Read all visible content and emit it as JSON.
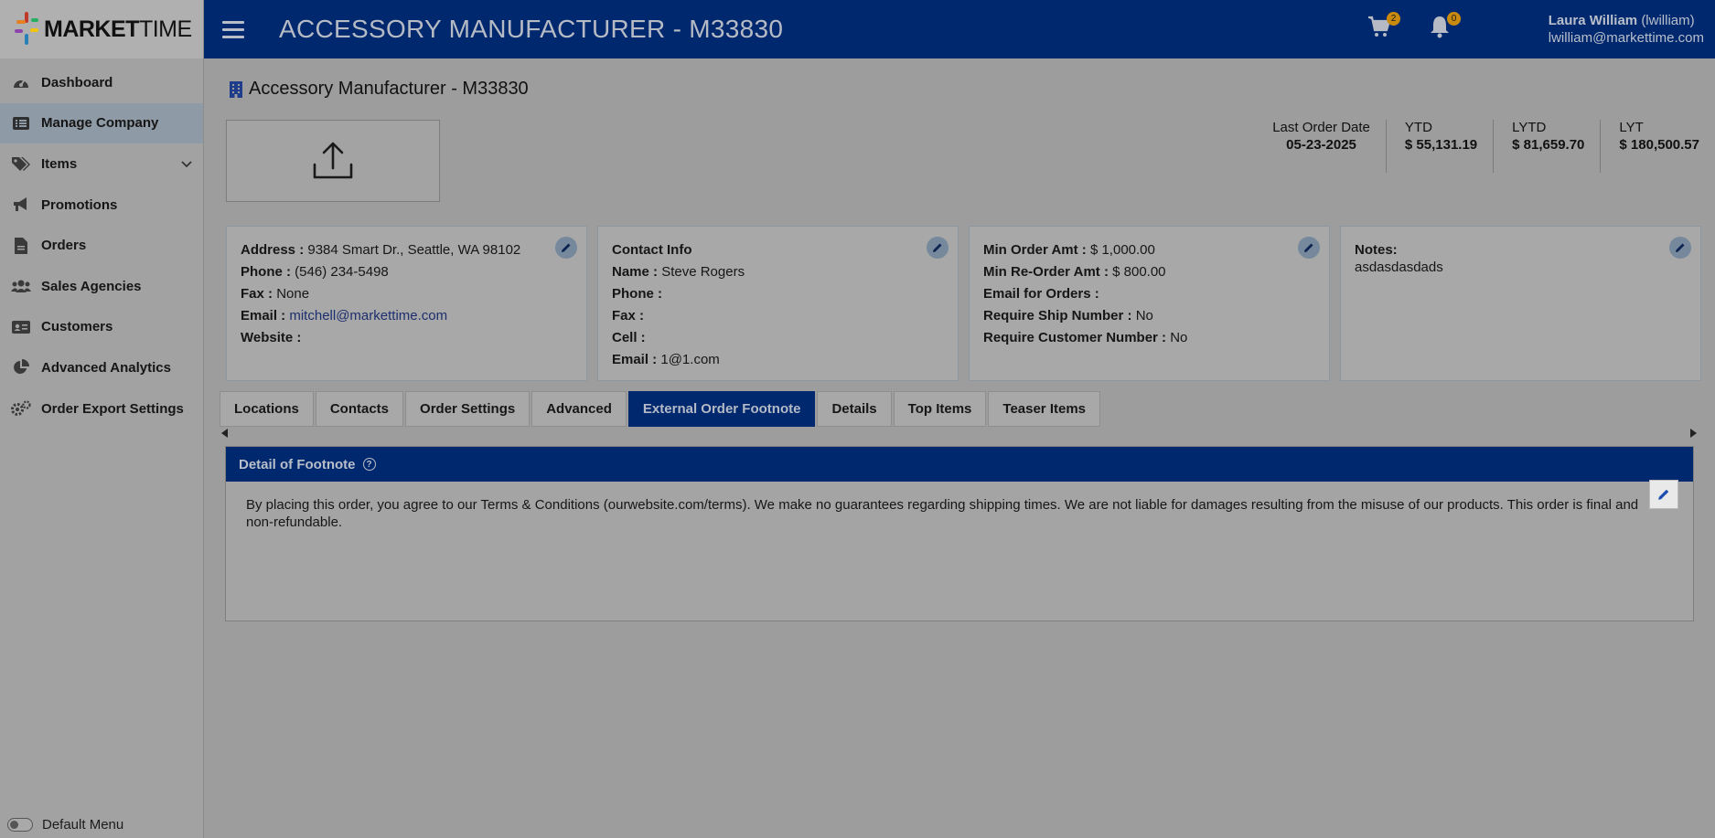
{
  "app": {
    "logo_bold": "MARKET",
    "logo_light": "TIME",
    "page_heading": "ACCESSORY MANUFACTURER - M33830"
  },
  "colors": {
    "brand_navy": "#00286e",
    "badge": "#c98a10"
  },
  "header": {
    "cart_count": "2",
    "notification_count": "0",
    "user_name": "Laura William",
    "user_handle": "(lwilliam)",
    "user_email": "lwilliam@markettime.com"
  },
  "sidebar": {
    "items": [
      {
        "label": "Dashboard",
        "icon": "dashboard-gauge-icon"
      },
      {
        "label": "Manage Company",
        "icon": "list-icon"
      },
      {
        "label": "Items",
        "icon": "tags-icon"
      },
      {
        "label": "Promotions",
        "icon": "megaphone-icon"
      },
      {
        "label": "Orders",
        "icon": "document-icon"
      },
      {
        "label": "Sales Agencies",
        "icon": "users-icon"
      },
      {
        "label": "Customers",
        "icon": "id-card-icon"
      },
      {
        "label": "Advanced Analytics",
        "icon": "pie-chart-icon"
      },
      {
        "label": "Order Export Settings",
        "icon": "gears-icon"
      }
    ],
    "default_menu_label": "Default Menu"
  },
  "company": {
    "title": "Accessory Manufacturer - M33830"
  },
  "stats": {
    "last_order_label": "Last Order Date",
    "last_order_value": "05-23-2025",
    "ytd_label": "YTD",
    "ytd_value": "$ 55,131.19",
    "lytd_label": "LYTD",
    "lytd_value": "$ 81,659.70",
    "lyt_label": "LYT",
    "lyt_value": "$ 180,500.57"
  },
  "address_card": {
    "address_label": "Address :",
    "address_value": "9384 Smart Dr., Seattle, WA 98102",
    "phone_label": "Phone :",
    "phone_value": "(546) 234-5498",
    "fax_label": "Fax :",
    "fax_value": "None",
    "email_label": "Email :",
    "email_value": "mitchell@markettime.com",
    "website_label": "Website :"
  },
  "contact_card": {
    "heading": "Contact Info",
    "name_label": "Name :",
    "name_value": "Steve Rogers",
    "phone_label": "Phone :",
    "fax_label": "Fax :",
    "cell_label": "Cell :",
    "email_label": "Email :",
    "email_value": "1@1.com"
  },
  "order_card": {
    "min_order_label": "Min Order Amt :",
    "min_order_value": "$ 1,000.00",
    "min_reorder_label": "Min Re-Order Amt :",
    "min_reorder_value": "$ 800.00",
    "email_orders_label": "Email for Orders :",
    "ship_number_label": "Require Ship Number :",
    "ship_number_value": "No",
    "customer_number_label": "Require Customer Number :",
    "customer_number_value": "No"
  },
  "notes_card": {
    "label": "Notes:",
    "value": "asdasdasdads"
  },
  "tabs": [
    {
      "label": "Locations"
    },
    {
      "label": "Contacts"
    },
    {
      "label": "Order Settings"
    },
    {
      "label": "Advanced"
    },
    {
      "label": "External Order Footnote",
      "active": true
    },
    {
      "label": "Details"
    },
    {
      "label": "Top Items"
    },
    {
      "label": "Teaser Items"
    }
  ],
  "footnote": {
    "heading": "Detail of Footnote",
    "help": "?",
    "text": "By placing this order, you agree to our Terms & Conditions (ourwebsite.com/terms). We make no guarantees regarding shipping times. We are not liable for damages resulting from the misuse of our products. This order is final and non-refundable."
  }
}
